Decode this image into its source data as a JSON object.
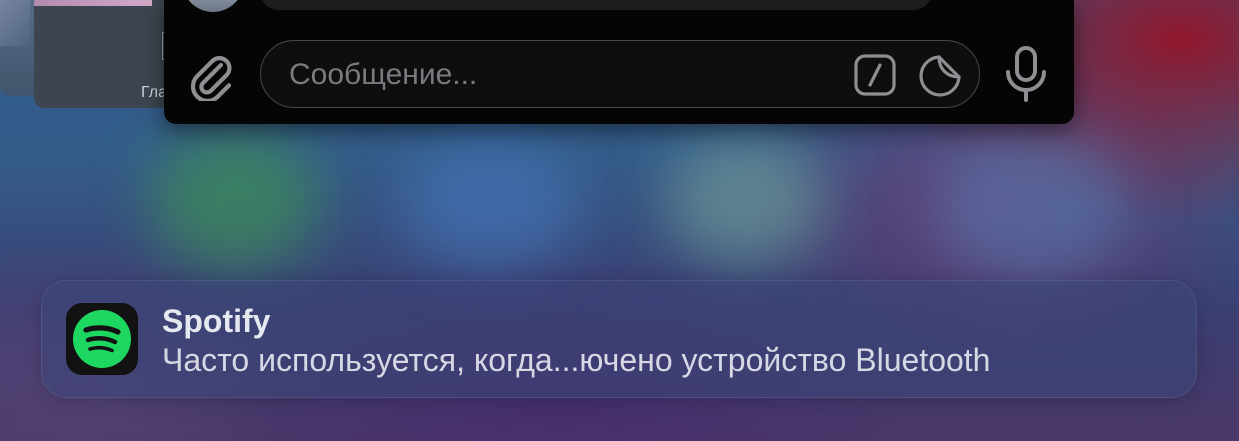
{
  "background_window": {
    "label": "Гла"
  },
  "composer": {
    "placeholder": "Сообщение...",
    "attach_icon": "paperclip-icon",
    "command_icon": "slash-command-icon",
    "sticker_icon": "sticker-icon",
    "mic_icon": "microphone-icon",
    "colors": {
      "panel": "#050505",
      "field_border": "#48484c",
      "icon": "#8e8e93"
    }
  },
  "notification": {
    "app_name": "Spotify",
    "message": "Часто используется, когда...ючено устройство Bluetooth",
    "icon": "spotify-logo-icon",
    "colors": {
      "brand": "#1ed760"
    }
  }
}
